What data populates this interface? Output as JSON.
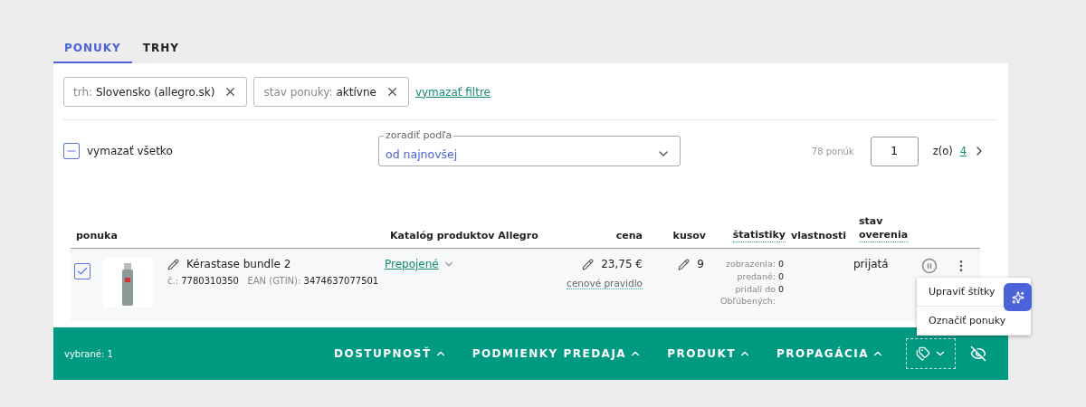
{
  "tabs": [
    {
      "label": "PONUKY",
      "selected": true
    },
    {
      "label": "TRHY",
      "selected": false
    }
  ],
  "filters": [
    {
      "label": "trh:",
      "value": "Slovensko (allegro.sk)"
    },
    {
      "label": "stav ponuky:",
      "value": "aktívne"
    }
  ],
  "clear_filters": "vymazať filtre",
  "select_all": {
    "label": "vymazať všetko",
    "indeterminate": true
  },
  "sort": {
    "label": "zoradiť podľa",
    "value": "od najnovšej"
  },
  "count": "78 ponúk",
  "pagination": {
    "page": "1",
    "of": "z(o)",
    "total": "4"
  },
  "columns": [
    {
      "label": "ponuka",
      "hint": false
    },
    {
      "label": "Katalóg produktov Allegro",
      "hint": false
    },
    {
      "label": "cena",
      "hint": false
    },
    {
      "label": "kusov",
      "hint": false
    },
    {
      "label": "štatistiky",
      "hint": true
    },
    {
      "label": "vlastnosti",
      "hint": false
    },
    {
      "label": "stav overenia",
      "hint": true
    }
  ],
  "rows": [
    {
      "selected": true,
      "kind": "picture",
      "name": "Kérastase bundle 2",
      "number_label": "č.:",
      "number": "7780310350",
      "ean_label": "EAN (GTIN):",
      "ean": "3474637077501",
      "catalog": "Prepojené",
      "price": "23,75 €",
      "price_rule": "cenové pravidlo",
      "quantity": "9",
      "stats": [
        {
          "label": "zobrazenia:",
          "value": "0"
        },
        {
          "label": "predané:",
          "value": "0"
        },
        {
          "label": "pridali do Obľúbených:",
          "value": "0"
        }
      ],
      "status": "prijatá"
    }
  ],
  "bottom_bar": {
    "selected_text": "vybrané: 1",
    "menus": [
      "DOSTUPNOSŤ",
      "PODMIENKY PREDAJA",
      "PRODUKT",
      "PROPAGÁCIA"
    ]
  },
  "menu_items": [
    "Upraviť štítky",
    "Označiť ponuky"
  ]
}
